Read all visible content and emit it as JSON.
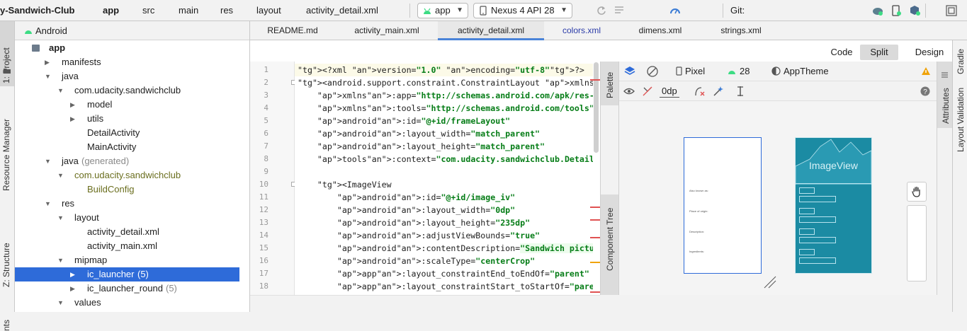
{
  "toolbar": {
    "breadcrumbs": [
      "y-Sandwich-Club",
      "app",
      "src",
      "main",
      "res",
      "layout",
      "activity_detail.xml"
    ],
    "run_config": "app",
    "device": "Nexus 4 API 28",
    "git_label": "Git:"
  },
  "left_strip": {
    "project": "1: Project",
    "resource_manager": "Resource Manager",
    "structure": "Z: Structure",
    "favorites": "nts"
  },
  "project": {
    "view_mode": "Android",
    "tree": [
      {
        "label": "app",
        "bold": true
      },
      {
        "label": "manifests"
      },
      {
        "label": "java"
      },
      {
        "label": "com.udacity.sandwichclub"
      },
      {
        "label": "model"
      },
      {
        "label": "utils"
      },
      {
        "label": "DetailActivity"
      },
      {
        "label": "MainActivity"
      },
      {
        "label": "java",
        "suffix": "(generated)"
      },
      {
        "label": "com.udacity.sandwichclub"
      },
      {
        "label": "BuildConfig"
      },
      {
        "label": "res"
      },
      {
        "label": "layout"
      },
      {
        "label": "activity_detail.xml"
      },
      {
        "label": "activity_main.xml"
      },
      {
        "label": "mipmap"
      },
      {
        "label": "ic_launcher",
        "suffix": "(5)",
        "selected": true
      },
      {
        "label": "ic_launcher_round",
        "suffix": "(5)"
      },
      {
        "label": "values"
      }
    ]
  },
  "tabs": [
    "README.md",
    "activity_main.xml",
    "activity_detail.xml",
    "colors.xml",
    "dimens.xml",
    "strings.xml"
  ],
  "active_tab": "activity_detail.xml",
  "modes": [
    "Code",
    "Split",
    "Design"
  ],
  "active_mode": "Split",
  "code": {
    "line_numbers": [
      "1",
      "2",
      "3",
      "4",
      "5",
      "6",
      "7",
      "8",
      "9",
      "10",
      "11",
      "12",
      "13",
      "14",
      "15",
      "16",
      "17",
      "18"
    ],
    "lines": [
      "<?xml version=\"1.0\" encoding=\"utf-8\"?>",
      "<android.support.constraint.ConstraintLayout xmlns:android=\"h",
      "    xmlns:app=\"http://schemas.android.com/apk/res-auto\"",
      "    xmlns:tools=\"http://schemas.android.com/tools\"",
      "    android:id=\"@+id/frameLayout\"",
      "    android:layout_width=\"match_parent\"",
      "    android:layout_height=\"match_parent\"",
      "    tools:context=\"com.udacity.sandwichclub.DetailActivity\">",
      "",
      "    <ImageView",
      "        android:id=\"@+id/image_iv\"",
      "        android:layout_width=\"0dp\"",
      "        android:layout_height=\"235dp\"",
      "        android:adjustViewBounds=\"true\"",
      "        android:contentDescription=\"Sandwich picture\"",
      "        android:scaleType=\"centerCrop\"",
      "        app:layout_constraintEnd_toEndOf=\"parent\"",
      "        app:layout_constraintStart_toStartOf=\"parent\""
    ]
  },
  "side_panels": {
    "palette": "Palette",
    "component_tree": "Component Tree",
    "attributes": "Attributes",
    "gradle": "Gradle",
    "layout_validation": "Layout Validation"
  },
  "design": {
    "device": "Pixel",
    "api": "28",
    "theme": "AppTheme",
    "margin": "0dp",
    "preview_labels": [
      "Also known as:",
      "Place of origin:",
      "Description:",
      "Ingredients:"
    ],
    "blueprint_image": "ImageView"
  },
  "colors": {
    "accent": "#2e6bd9",
    "blueprint": "#1b8ba3",
    "tag": "#000080",
    "attr_value": "#067d17",
    "warning": "#f0a30a",
    "error_mark": "#e05252"
  }
}
